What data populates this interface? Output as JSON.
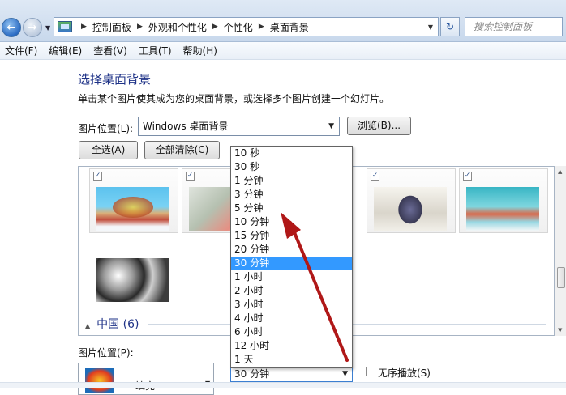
{
  "address_bar": {
    "crumbs": [
      "控制面板",
      "外观和个性化",
      "个性化",
      "桌面背景"
    ],
    "search_placeholder": "搜索控制面板"
  },
  "menu": [
    "文件(F)",
    "编辑(E)",
    "查看(V)",
    "工具(T)",
    "帮助(H)"
  ],
  "content": {
    "title": "选择桌面背景",
    "description": "单击某个图片使其成为您的桌面背景，或选择多个图片创建一个幻灯片。",
    "location_label": "图片位置(L):",
    "location_value": "Windows 桌面背景",
    "browse_label": "浏览(B)...",
    "select_all_label": "全选(A)",
    "clear_all_label": "全部清除(C)",
    "group_label": "中国 (6)",
    "position_label": "图片位置(P):",
    "position_value": "填充",
    "shuffle_label": "无序播放(S)"
  },
  "interval_dropdown": {
    "options": [
      "10 秒",
      "30 秒",
      "1 分钟",
      "3 分钟",
      "5 分钟",
      "10 分钟",
      "15 分钟",
      "20 分钟",
      "30 分钟",
      "1 小时",
      "2 小时",
      "3 小时",
      "4 小时",
      "6 小时",
      "12 小时",
      "1 天"
    ],
    "selected": "30 分钟"
  },
  "colors": {
    "title_blue": "#1e3287",
    "highlight": "#3399ff",
    "annotation_arrow": "#b01818"
  }
}
